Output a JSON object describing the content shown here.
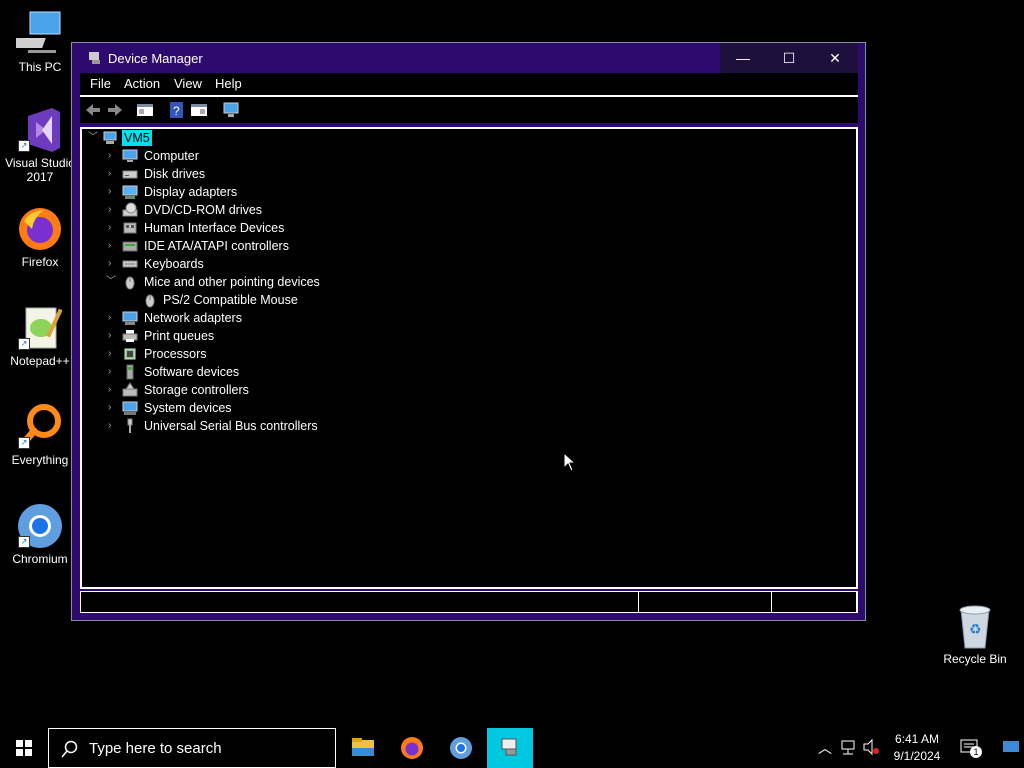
{
  "desktop": {
    "icons": [
      {
        "label": "This PC",
        "icon": "computer-icon"
      },
      {
        "label": "Visual Studio 2017",
        "icon": "visual-studio-icon"
      },
      {
        "label": "Firefox",
        "icon": "firefox-icon"
      },
      {
        "label": "Notepad++",
        "icon": "notepadpp-icon"
      },
      {
        "label": "Everything",
        "icon": "search-magnifier-icon"
      },
      {
        "label": "Chromium",
        "icon": "chromium-icon"
      },
      {
        "label": "Recycle Bin",
        "icon": "recycle-bin-icon"
      }
    ]
  },
  "window": {
    "title": "Device Manager",
    "controls": {
      "minimize": "—",
      "maximize": "☐",
      "close": "✕"
    },
    "menu": [
      "File",
      "Action",
      "View",
      "Help"
    ],
    "tree": {
      "root": "VM5",
      "items": [
        {
          "label": "Computer",
          "expanded": false,
          "icon": "monitor-icon"
        },
        {
          "label": "Disk drives",
          "expanded": false,
          "icon": "disk-drive-icon"
        },
        {
          "label": "Display adapters",
          "expanded": false,
          "icon": "display-adapter-icon"
        },
        {
          "label": "DVD/CD-ROM drives",
          "expanded": false,
          "icon": "dvd-drive-icon"
        },
        {
          "label": "Human Interface Devices",
          "expanded": false,
          "icon": "hid-icon"
        },
        {
          "label": "IDE ATA/ATAPI controllers",
          "expanded": false,
          "icon": "ide-controller-icon"
        },
        {
          "label": "Keyboards",
          "expanded": false,
          "icon": "keyboard-icon"
        },
        {
          "label": "Mice and other pointing devices",
          "expanded": true,
          "icon": "mouse-icon",
          "children": [
            {
              "label": "PS/2 Compatible Mouse",
              "icon": "mouse-icon"
            }
          ]
        },
        {
          "label": "Network adapters",
          "expanded": false,
          "icon": "network-adapter-icon"
        },
        {
          "label": "Print queues",
          "expanded": false,
          "icon": "printer-icon"
        },
        {
          "label": "Processors",
          "expanded": false,
          "icon": "processor-icon"
        },
        {
          "label": "Software devices",
          "expanded": false,
          "icon": "software-device-icon"
        },
        {
          "label": "Storage controllers",
          "expanded": false,
          "icon": "storage-controller-icon"
        },
        {
          "label": "System devices",
          "expanded": false,
          "icon": "system-device-icon"
        },
        {
          "label": "Universal Serial Bus controllers",
          "expanded": false,
          "icon": "usb-icon"
        }
      ]
    }
  },
  "taskbar": {
    "search_placeholder": "Type here to search",
    "time": "6:41 AM",
    "date": "9/1/2024",
    "notification_count": "1"
  },
  "colors": {
    "accent": "#2d0a6e",
    "selection": "#00e0f0",
    "active_taskbar_app": "#00c8e0"
  }
}
